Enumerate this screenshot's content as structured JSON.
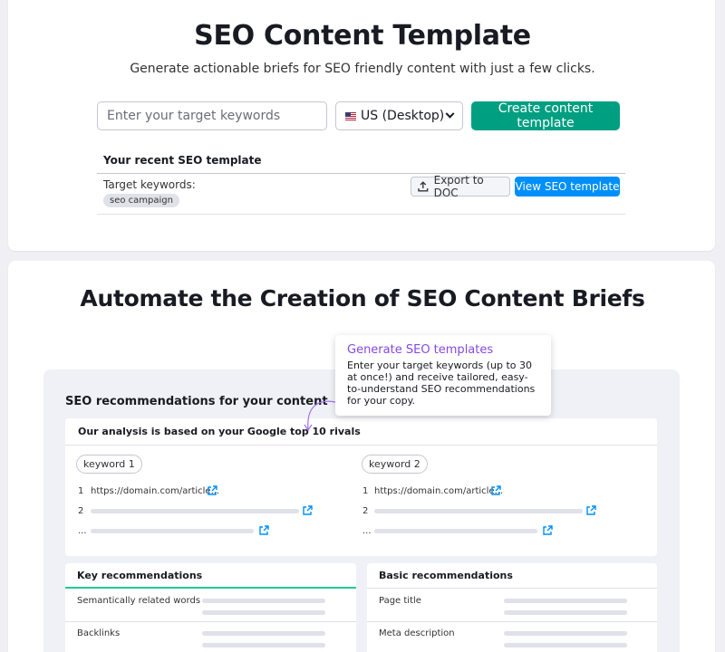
{
  "header": {
    "title": "SEO Content Template",
    "subtitle": "Generate actionable briefs for SEO friendly content with just a few clicks."
  },
  "form": {
    "keyword_placeholder": "Enter your target keywords",
    "country_value": "US (Desktop)",
    "create_label": "Create content template"
  },
  "recent": {
    "heading": "Your recent SEO template",
    "target_label": "Target keywords:",
    "tag": "seo campaign",
    "export_label": "Export to DOC",
    "view_label": "View SEO template"
  },
  "promo": {
    "title": "Automate the Creation of SEO Content Briefs",
    "preview_title": "SEO recommendations for your content",
    "analysis_heading": "Our analysis is based on your Google top 10 rivals",
    "keywords": [
      {
        "label": "keyword 1",
        "rows": [
          "1",
          "2",
          "..."
        ],
        "url": "https://domain.com/article..."
      },
      {
        "label": "keyword 2",
        "rows": [
          "1",
          "2",
          "..."
        ],
        "url": "https://domain.com/article..."
      }
    ],
    "key_recs": {
      "heading": "Key recommendations",
      "items": [
        "Semantically related words",
        "Backlinks"
      ]
    },
    "basic_recs": {
      "heading": "Basic recommendations",
      "items": [
        "Page title",
        "Meta description"
      ]
    },
    "tooltip": {
      "title": "Generate SEO templates",
      "text": "Enter your target keywords (up to 30 at once!) and receive tailored, easy-to-understand SEO recommendations for your copy."
    }
  },
  "colors": {
    "primary_green": "#009f81",
    "primary_blue": "#008ff8",
    "tooltip_purple": "#8649e1",
    "accent_teal": "#20c997"
  }
}
